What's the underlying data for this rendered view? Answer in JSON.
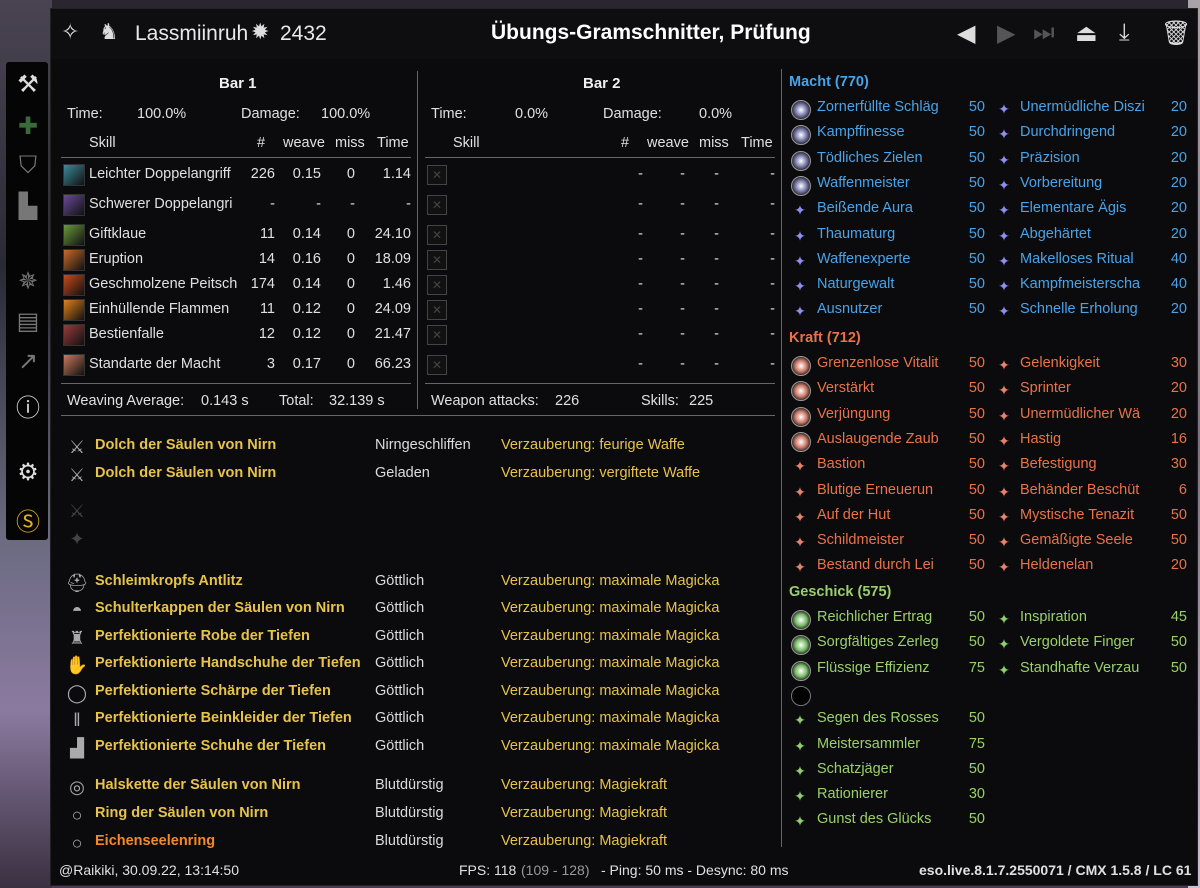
{
  "titlebar": {
    "character": "Lassmiinruh",
    "cp": "2432",
    "title": "Übungs-Gramschnitter, Prüfung"
  },
  "bar1": {
    "header": "Bar 1",
    "time_label": "Time:",
    "time_val": "100.0%",
    "damage_label": "Damage:",
    "damage_val": "100.0%",
    "cols": {
      "skill": "Skill",
      "count": "#",
      "weave": "weave",
      "miss": "miss",
      "time": "Time"
    },
    "skills": [
      {
        "name": "Leichter Doppelangriff",
        "count": "226",
        "weave": "0.15",
        "miss": "0",
        "time": "1.14",
        "color": "#3a8a9a"
      },
      {
        "name": "Schwerer Doppelangri",
        "count": "-",
        "weave": "-",
        "miss": "-",
        "time": "-",
        "color": "#6a4a9a"
      },
      {
        "name": "Giftklaue",
        "count": "11",
        "weave": "0.14",
        "miss": "0",
        "time": "24.10",
        "color": "#6a9a3a"
      },
      {
        "name": "Eruption",
        "count": "14",
        "weave": "0.16",
        "miss": "0",
        "time": "18.09",
        "color": "#c86a2a"
      },
      {
        "name": "Geschmolzene Peitsch",
        "count": "174",
        "weave": "0.14",
        "miss": "0",
        "time": "1.46",
        "color": "#c84a1a"
      },
      {
        "name": "Einhüllende Flammen",
        "count": "11",
        "weave": "0.12",
        "miss": "0",
        "time": "24.09",
        "color": "#e0801a"
      },
      {
        "name": "Bestienfalle",
        "count": "12",
        "weave": "0.12",
        "miss": "0",
        "time": "21.47",
        "color": "#9a3a3a"
      },
      {
        "name": "Standarte der Macht",
        "count": "3",
        "weave": "0.17",
        "miss": "0",
        "time": "66.23",
        "color": "#c87a5a"
      }
    ],
    "weaving_label": "Weaving Average:",
    "weaving_val": "0.143 s",
    "total_label": "Total:",
    "total_val": "32.139 s"
  },
  "bar2": {
    "header": "Bar 2",
    "time_label": "Time:",
    "time_val": "0.0%",
    "damage_label": "Damage:",
    "damage_val": "0.0%",
    "cols": {
      "skill": "Skill",
      "count": "#",
      "weave": "weave",
      "miss": "miss",
      "time": "Time"
    },
    "dash": "-",
    "weapon_label": "Weapon attacks:",
    "weapon_val": "226",
    "skills_label": "Skills:",
    "skills_val": "225"
  },
  "gear": [
    {
      "name": "Dolch der Säulen von Nirn",
      "trait": "Nirngeschliffen",
      "enchant": "Verzauberung: feurige Waffe",
      "icon": "dagger-icon"
    },
    {
      "name": "Dolch der Säulen von Nirn",
      "trait": "Geladen",
      "enchant": "Verzauberung: vergiftete Waffe",
      "icon": "dagger-icon"
    },
    {
      "name": "Schleimkropfs Antlitz",
      "trait": "Göttlich",
      "enchant": "Verzauberung: maximale Magicka",
      "icon": "helmet-icon"
    },
    {
      "name": "Schulterkappen der Säulen von Nirn",
      "trait": "Göttlich",
      "enchant": "Verzauberung: maximale Magicka",
      "icon": "shoulder-icon"
    },
    {
      "name": "Perfektionierte Robe der Tiefen",
      "trait": "Göttlich",
      "enchant": "Verzauberung: maximale Magicka",
      "icon": "robe-icon"
    },
    {
      "name": "Perfektionierte Handschuhe der Tiefen",
      "trait": "Göttlich",
      "enchant": "Verzauberung: maximale Magicka",
      "icon": "gloves-icon"
    },
    {
      "name": "Perfektionierte Schärpe der Tiefen",
      "trait": "Göttlich",
      "enchant": "Verzauberung: maximale Magicka",
      "icon": "belt-icon"
    },
    {
      "name": "Perfektionierte Beinkleider der Tiefen",
      "trait": "Göttlich",
      "enchant": "Verzauberung: maximale Magicka",
      "icon": "legs-icon"
    },
    {
      "name": "Perfektionierte Schuhe der Tiefen",
      "trait": "Göttlich",
      "enchant": "Verzauberung: maximale Magicka",
      "icon": "boots-icon"
    },
    {
      "name": "Halskette der Säulen von Nirn",
      "trait": "Blutdürstig",
      "enchant": "Verzauberung: Magiekraft",
      "icon": "necklace-icon"
    },
    {
      "name": "Ring der Säulen von Nirn",
      "trait": "Blutdürstig",
      "enchant": "Verzauberung: Magiekraft",
      "icon": "ring-icon"
    },
    {
      "name": "Eichenseelenring",
      "trait": "Blutdürstig",
      "enchant": "Verzauberung: Magiekraft",
      "icon": "ring-icon"
    }
  ],
  "cp": {
    "macht": {
      "header": "Macht (770)",
      "color": "#4aa3e6",
      "left": [
        {
          "n": "Zornerfüllte Schläg",
          "v": "50",
          "s": "slot"
        },
        {
          "n": "Kampffinesse",
          "v": "50",
          "s": "slot"
        },
        {
          "n": "Tödliches Zielen",
          "v": "50",
          "s": "slot"
        },
        {
          "n": "Waffenmeister",
          "v": "50",
          "s": "slot"
        },
        {
          "n": "Beißende Aura",
          "v": "50",
          "s": "pass"
        },
        {
          "n": "Thaumaturg",
          "v": "50",
          "s": "pass"
        },
        {
          "n": "Waffenexperte",
          "v": "50",
          "s": "pass"
        },
        {
          "n": "Naturgewalt",
          "v": "50",
          "s": "pass"
        },
        {
          "n": "Ausnutzer",
          "v": "50",
          "s": "pass"
        }
      ],
      "right": [
        {
          "n": "Unermüdliche Diszi",
          "v": "20"
        },
        {
          "n": "Durchdringend",
          "v": "20"
        },
        {
          "n": "Präzision",
          "v": "20"
        },
        {
          "n": "Vorbereitung",
          "v": "20"
        },
        {
          "n": "Elementare Ägis",
          "v": "20"
        },
        {
          "n": "Abgehärtet",
          "v": "20"
        },
        {
          "n": "Makelloses Ritual",
          "v": "40"
        },
        {
          "n": "Kampfmeisterscha",
          "v": "40"
        },
        {
          "n": "Schnelle Erholung",
          "v": "20"
        }
      ]
    },
    "kraft": {
      "header": "Kraft (712)",
      "color": "#e8734a",
      "left": [
        {
          "n": "Grenzenlose Vitalit",
          "v": "50",
          "s": "slot"
        },
        {
          "n": "Verstärkt",
          "v": "50",
          "s": "slot"
        },
        {
          "n": "Verjüngung",
          "v": "50",
          "s": "slot"
        },
        {
          "n": "Auslaugende Zaub",
          "v": "50",
          "s": "slot"
        },
        {
          "n": "Bastion",
          "v": "50",
          "s": "pass"
        },
        {
          "n": "Blutige Erneuerun",
          "v": "50",
          "s": "pass"
        },
        {
          "n": "Auf der Hut",
          "v": "50",
          "s": "pass"
        },
        {
          "n": "Schildmeister",
          "v": "50",
          "s": "pass"
        },
        {
          "n": "Bestand durch Lei",
          "v": "50",
          "s": "pass"
        }
      ],
      "right": [
        {
          "n": "Gelenkigkeit",
          "v": "30"
        },
        {
          "n": "Sprinter",
          "v": "20"
        },
        {
          "n": "Unermüdlicher Wä",
          "v": "20"
        },
        {
          "n": "Hastig",
          "v": "16"
        },
        {
          "n": "Befestigung",
          "v": "30"
        },
        {
          "n": "Behänder Beschüt",
          "v": "6"
        },
        {
          "n": "Mystische Tenazit",
          "v": "50"
        },
        {
          "n": "Gemäßigte Seele",
          "v": "50"
        },
        {
          "n": "Heldenelan",
          "v": "20"
        }
      ]
    },
    "geschick": {
      "header": "Geschick (575)",
      "color": "#9ad06a",
      "left": [
        {
          "n": "Reichlicher Ertrag",
          "v": "50",
          "s": "slot"
        },
        {
          "n": "Sorgfältiges Zerleg",
          "v": "50",
          "s": "slot"
        },
        {
          "n": "Flüssige Effizienz",
          "v": "75",
          "s": "slot"
        },
        {
          "n": "",
          "v": "",
          "s": "empty"
        },
        {
          "n": "Segen des Rosses",
          "v": "50",
          "s": "pass"
        },
        {
          "n": "Meistersammler",
          "v": "75",
          "s": "pass"
        },
        {
          "n": "Schatzjäger",
          "v": "50",
          "s": "pass"
        },
        {
          "n": "Rationierer",
          "v": "30",
          "s": "pass"
        },
        {
          "n": "Gunst des Glücks",
          "v": "50",
          "s": "pass"
        }
      ],
      "right": [
        {
          "n": "Inspiration",
          "v": "45"
        },
        {
          "n": "Vergoldete Finger",
          "v": "50"
        },
        {
          "n": "Standhafte Verzau",
          "v": "50"
        }
      ]
    }
  },
  "footer": {
    "user": "@Raikiki, 30.09.22, 13:14:50",
    "fps": "FPS: 118",
    "fps_range": "(109 - 128)",
    "ping": "- Ping: 50 ms - Desync: 80 ms",
    "version": "eso.live.8.1.7.2550071 / CMX 1.5.8 / LC 61"
  }
}
